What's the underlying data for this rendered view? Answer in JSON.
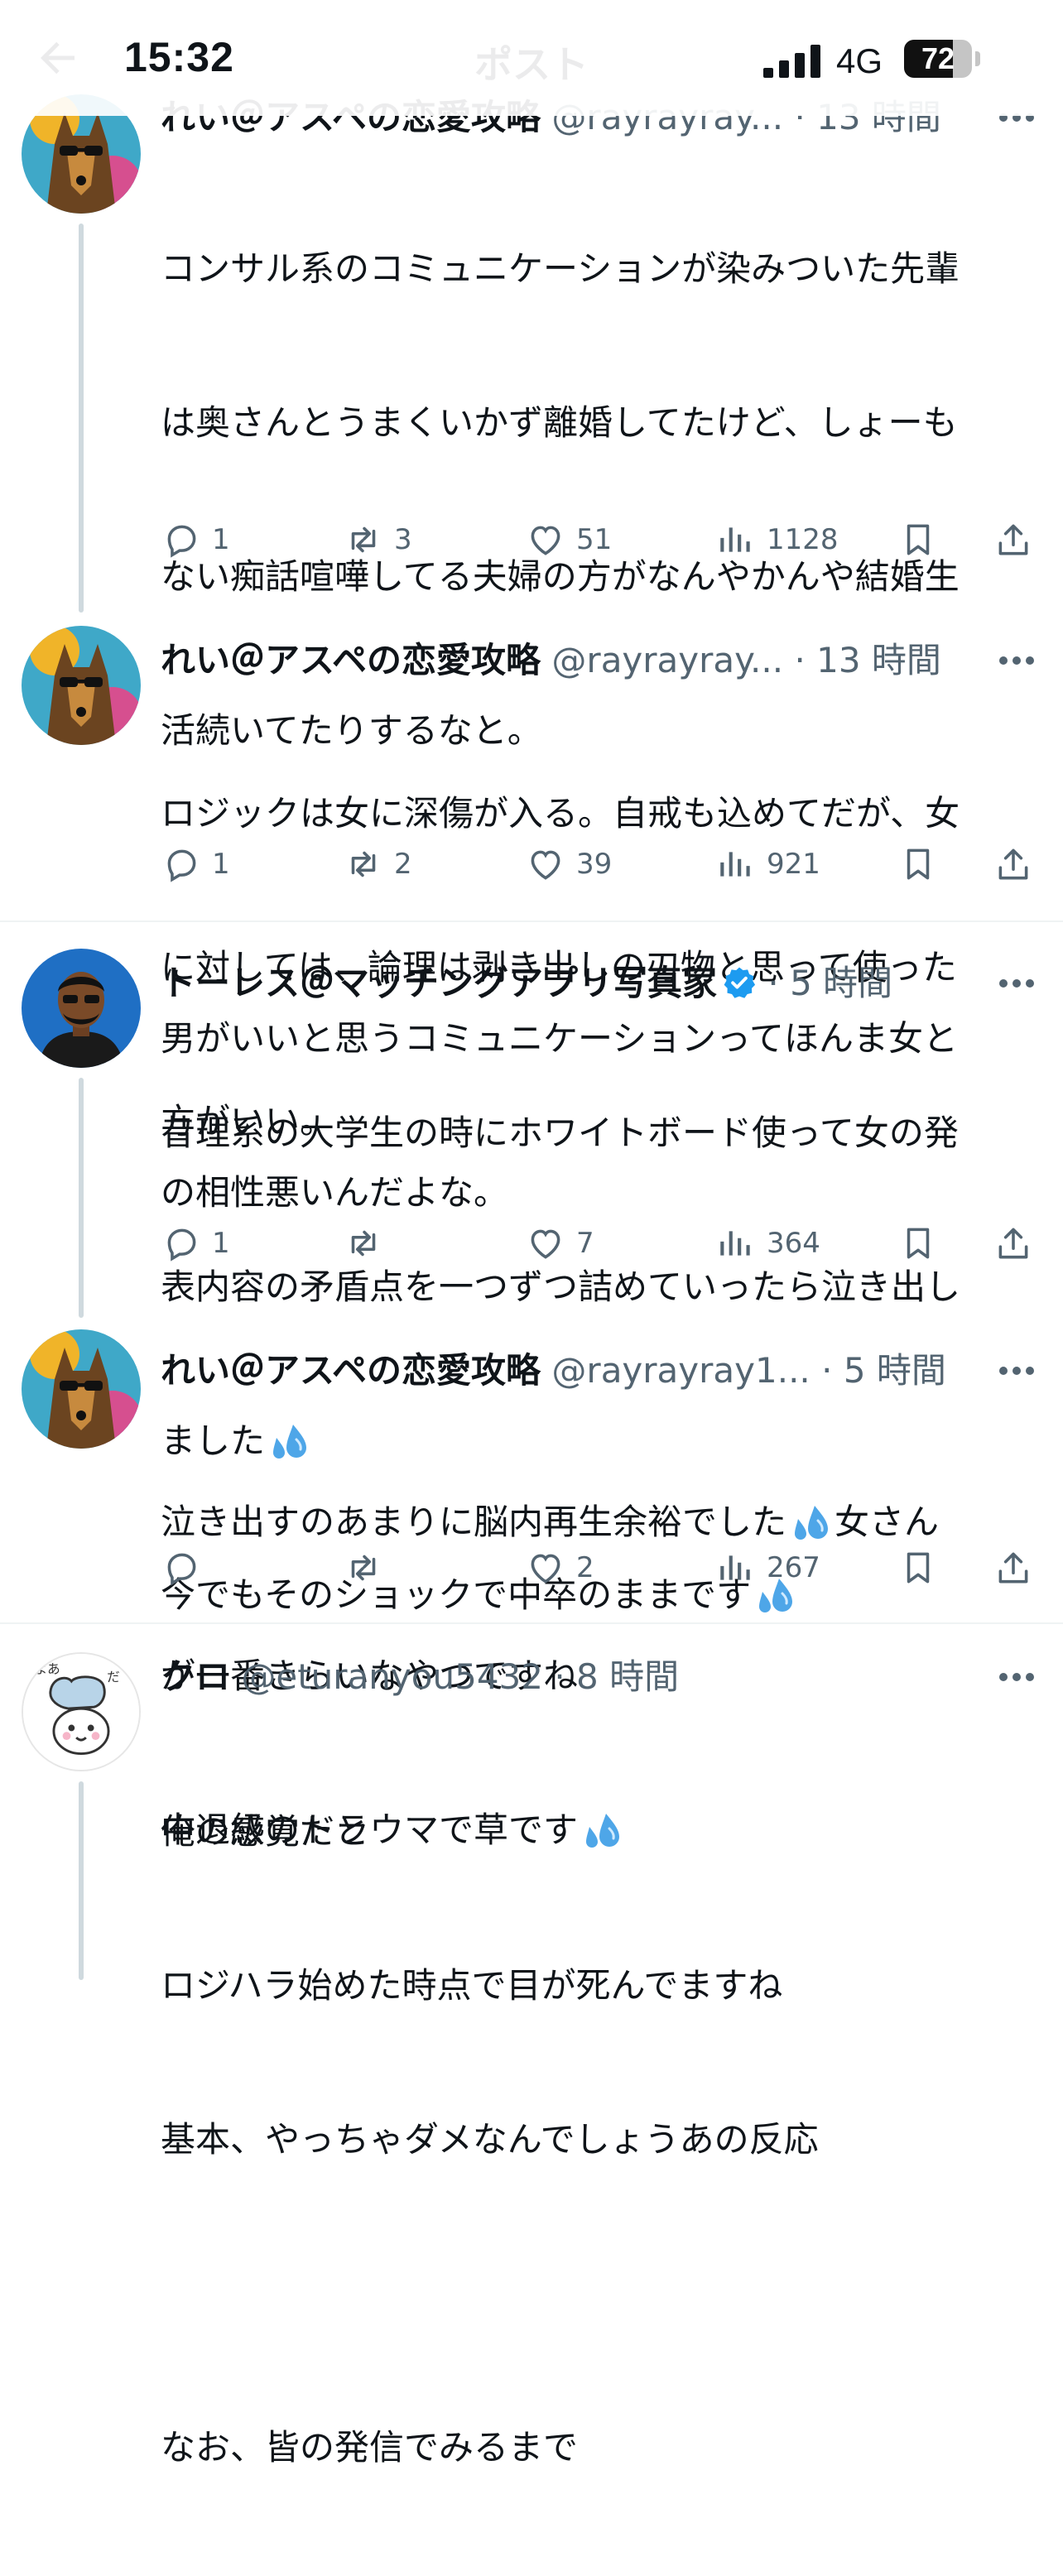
{
  "status_bar": {
    "time": "15:32",
    "network": "4G",
    "battery_level": 72,
    "battery_label": "72"
  },
  "header": {
    "title": "ポスト"
  },
  "posts": [
    {
      "name": "れい＠アスペの恋愛攻略",
      "handle": "@rayrayray...",
      "meta": "· 13 時間",
      "body_lines": [
        "コンサル系のコミュニケーションが染みついた先輩",
        "は奥さんとうまくいかず離婚してたけど、しょーも",
        "ない痴話喧嘩してる夫婦の方がなんやかんや結婚生",
        "活続いてたりするなと。",
        "",
        "男がいいと思うコミュニケーションってほんま女と",
        "の相性悪いんだよな。"
      ],
      "replies": "1",
      "reposts": "3",
      "likes": "51",
      "views": "1128"
    },
    {
      "name": "れい＠アスペの恋愛攻略",
      "handle": "@rayrayray...",
      "meta": "· 13 時間",
      "body_lines": [
        "ロジックは女に深傷が入る。自戒も込めてだが、女",
        "に対しては、論理は剥き出しの刃物と思って使った",
        "方がいい。"
      ],
      "replies": "1",
      "reposts": "2",
      "likes": "39",
      "views": "921"
    },
    {
      "name": "トーレス＠マッチングアプリ写真家",
      "handle": "",
      "meta": "· 5 時間",
      "verified": true,
      "body_lines": [
        "昔理系の大学生の時にホワイトボード使って女の発",
        "表内容の矛盾点を一つずつ詰めていったら泣き出し",
        "ました",
        "今でもそのショックで中卒のままです"
      ],
      "replies": "1",
      "reposts": "",
      "likes": "7",
      "views": "364"
    },
    {
      "name": "れい＠アスペの恋愛攻略",
      "handle": "@rayrayray1...",
      "meta": "· 5 時間",
      "body_lines": [
        "泣き出すのあまりに脳内再生余裕でした",
        "女さん",
        "が一番きらいなやつですね",
        "中退級のトラウマで草です"
      ],
      "replies": "",
      "reposts": "",
      "likes": "2",
      "views": "267"
    },
    {
      "name": "クロ",
      "handle": "@eturanyou5432",
      "meta": "· 8 時間",
      "body_lines": [
        "俺の感覚だと",
        "ロジハラ始めた時点で目が死んでますね",
        "基本、やっちゃダメなんでしょうあの反応",
        "",
        "なお、皆の発信でみるまで"
      ]
    }
  ],
  "colors": {
    "text": "#0f1419",
    "secondary": "#536471",
    "verified": "#1d9bf0",
    "thread_line": "#cfd9de"
  }
}
